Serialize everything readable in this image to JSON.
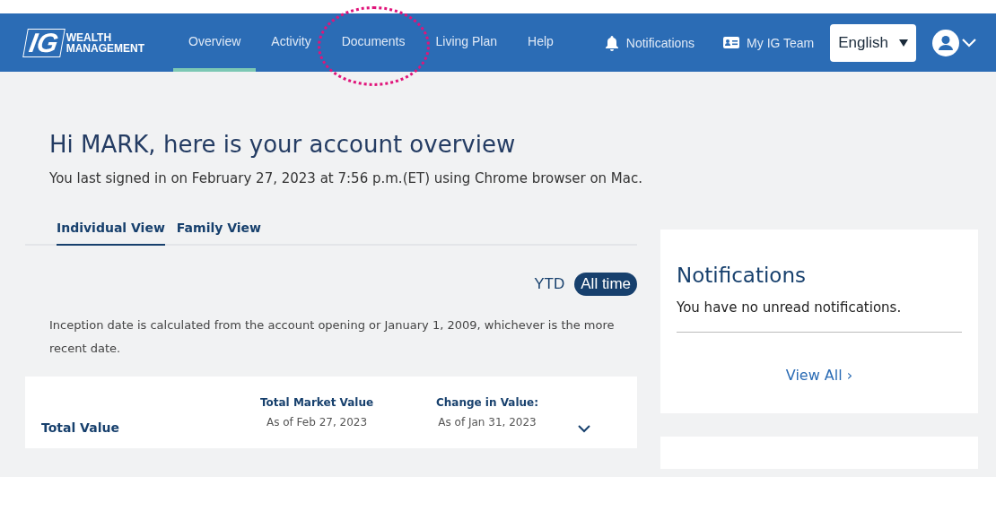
{
  "logo": {
    "mark": "IG",
    "line_1": "WEALTH",
    "line_2": "MANAGEMENT"
  },
  "nav": [
    {
      "label": "Overview",
      "selected": true,
      "highlighted": false
    },
    {
      "label": "Activity",
      "selected": false,
      "highlighted": false
    },
    {
      "label": "Documents",
      "selected": false,
      "highlighted": true
    },
    {
      "label": "Living Plan",
      "selected": false,
      "highlighted": false
    },
    {
      "label": "Help",
      "selected": false,
      "highlighted": false
    }
  ],
  "nav_links": [
    {
      "label": "Notifications",
      "kind": "bell"
    },
    {
      "label": "My IG Team",
      "kind": "card"
    }
  ],
  "language": {
    "value": "English"
  },
  "greeting": "Hi MARK, here is your account overview",
  "last_signed_in": "You last signed in on February 27, 2023 at 7:56 p.m.(ET) using Chrome browser on Mac.",
  "view_tabs": [
    {
      "label": "Individual View",
      "selected": true
    },
    {
      "label": "Family View",
      "selected": false
    }
  ],
  "period": [
    {
      "label": "YTD",
      "selected": false
    },
    {
      "label": "All time",
      "selected": true
    }
  ],
  "inception_note": "Inception date is calculated from the account opening or January 1, 2009, whichever is the more recent date.",
  "summary": {
    "title": "Total Value",
    "columns": [
      {
        "heading": "Total Market Value",
        "date": "As of Feb 27, 2023"
      },
      {
        "heading": "Change in Value:",
        "date": "As of Jan 31, 2023"
      }
    ]
  },
  "notifications_card": {
    "title": "Notifications",
    "message": "You have no unread notifications.",
    "link": "View All ›"
  }
}
